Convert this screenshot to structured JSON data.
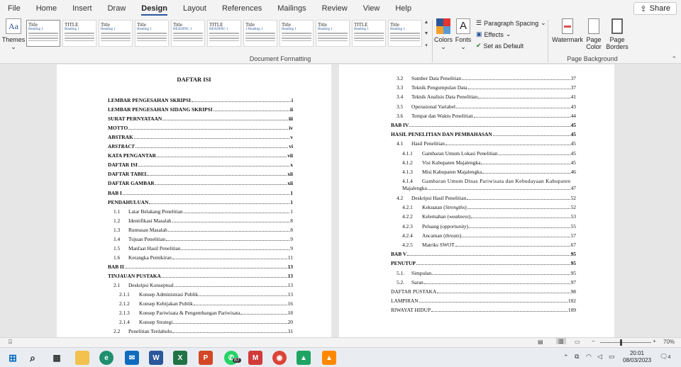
{
  "tabs": [
    "File",
    "Home",
    "Insert",
    "Draw",
    "Design",
    "Layout",
    "References",
    "Mailings",
    "Review",
    "View",
    "Help"
  ],
  "active_tab": "Design",
  "share_label": "Share",
  "ribbon": {
    "themes_label": "Themes",
    "gallery": [
      {
        "title": "Title",
        "sub": "Heading 1"
      },
      {
        "title": "TITLE",
        "sub": "Heading 1"
      },
      {
        "title": "Title",
        "sub": "Heading 1"
      },
      {
        "title": "Title",
        "sub": "Heading 1"
      },
      {
        "title": "Title",
        "sub": "HEADING 1"
      },
      {
        "title": "TITLE",
        "sub": "HEADING 1"
      },
      {
        "title": "Title",
        "sub": "1   Heading 1"
      },
      {
        "title": "Title",
        "sub": "Heading 1"
      },
      {
        "title": "Title",
        "sub": "Heading 1"
      },
      {
        "title": "TITLE",
        "sub": "Heading 1"
      },
      {
        "title": "Title",
        "sub": "Heading 1"
      }
    ],
    "colors_label": "Colors",
    "fonts_label": "Fonts",
    "paragraph_spacing_label": "Paragraph Spacing",
    "effects_label": "Effects",
    "set_default_label": "Set as Default",
    "document_formatting_label": "Document Formatting",
    "watermark_label": "Watermark",
    "page_color_label": "Page Color",
    "page_borders_label": "Page Borders",
    "page_background_label": "Page Background"
  },
  "page1": {
    "heading": "DAFTAR ISI",
    "entries": [
      {
        "num": "",
        "text": "LEMBAR PENGESAHAN SKRIPSI",
        "page": "i",
        "style": "b",
        "indent": 0
      },
      {
        "num": "",
        "text": "LEMBAR PENGESAHAN SIDANG SKRIPSI",
        "page": "ii",
        "style": "b",
        "indent": 0
      },
      {
        "num": "",
        "text": "SURAT PERNYATAAN",
        "page": "iii",
        "style": "b",
        "indent": 0
      },
      {
        "num": "",
        "text": "MOTTO",
        "page": "iv",
        "style": "b",
        "indent": 0
      },
      {
        "num": "",
        "text": "ABSTRAK",
        "page": "v",
        "style": "b",
        "indent": 0
      },
      {
        "num": "",
        "text": "ABSTRACT",
        "page": "vi",
        "style": "bi",
        "indent": 0
      },
      {
        "num": "",
        "text": "KATA PENGANTAR",
        "page": "vii",
        "style": "b",
        "indent": 0
      },
      {
        "num": "",
        "text": "DAFTAR ISI",
        "page": "x",
        "style": "b",
        "indent": 0
      },
      {
        "num": "",
        "text": "DAFTAR TABEL",
        "page": "xii",
        "style": "b",
        "indent": 0
      },
      {
        "num": "",
        "text": "DAFTAR GAMBAR",
        "page": "xii",
        "style": "b",
        "indent": 0
      },
      {
        "num": "",
        "text": "BAB I",
        "page": "1",
        "style": "b",
        "indent": 0
      },
      {
        "num": "",
        "text": "PENDAHULUAN",
        "page": "1",
        "style": "b",
        "indent": 0
      },
      {
        "num": "1.1",
        "text": "Latar Belakang Penelitian",
        "page": "1",
        "style": "",
        "indent": 1
      },
      {
        "num": "1.2",
        "text": "Identifikasi Masalah",
        "page": "8",
        "style": "",
        "indent": 1
      },
      {
        "num": "1.3",
        "text": "Rumusan Masalah",
        "page": "8",
        "style": "",
        "indent": 1
      },
      {
        "num": "1.4",
        "text": "Tujuan Penelitian",
        "page": "9",
        "style": "",
        "indent": 1
      },
      {
        "num": "1.5",
        "text": "Manfaat Hasil Penelitian",
        "page": "9",
        "style": "",
        "indent": 1
      },
      {
        "num": "1.6",
        "text": "Kerangka Pemikiran",
        "page": "11",
        "style": "",
        "indent": 1
      },
      {
        "num": "",
        "text": "BAB II",
        "page": "13",
        "style": "b",
        "indent": 0
      },
      {
        "num": "",
        "text": "TINJAUAN PUSTAKA",
        "page": "13",
        "style": "b",
        "indent": 0
      },
      {
        "num": "2.1",
        "text": "Deskripsi Konseptual",
        "page": "13",
        "style": "",
        "indent": 1
      },
      {
        "num": "2.1.1",
        "text": "Konsep Administrasi Publik",
        "page": "13",
        "style": "",
        "indent": 2
      },
      {
        "num": "2.1.2",
        "text": "Konsep Kebijakan Publik",
        "page": "16",
        "style": "",
        "indent": 2
      },
      {
        "num": "2.1.3",
        "text": "Konsep Pariwisata & Pengembangan Pariwisata",
        "page": "18",
        "style": "",
        "indent": 2
      },
      {
        "num": "2.1.4",
        "text": "Konsep Strategi",
        "page": "20",
        "style": "",
        "indent": 2
      },
      {
        "num": "2.2",
        "text": "Penelitian Terdahulu",
        "page": "31",
        "style": "",
        "indent": 1
      }
    ]
  },
  "page2": {
    "entries": [
      {
        "num": "3.2",
        "text": "Sumber Data Penelitian",
        "page": "37",
        "style": "",
        "indent": 1
      },
      {
        "num": "3.3",
        "text": "Teknik Pengumpulan Data",
        "page": "37",
        "style": "",
        "indent": 1
      },
      {
        "num": "3.4",
        "text": "Teknik Analisis Data Penelitian",
        "page": "41",
        "style": "",
        "indent": 1
      },
      {
        "num": "3.5",
        "text": "Operasional Variabel",
        "page": "43",
        "style": "",
        "indent": 1
      },
      {
        "num": "3.6",
        "text": "Tempat dan Waktu Penelitian",
        "page": "44",
        "style": "",
        "indent": 1
      },
      {
        "num": "",
        "text": "BAB IV",
        "page": "45",
        "style": "b",
        "indent": 0
      },
      {
        "num": "",
        "text": "HASIL PENELITIAN DAN PEMBAHASAN",
        "page": "45",
        "style": "b",
        "indent": 0
      },
      {
        "num": "4.1",
        "text": "Hasil Penelitian",
        "page": "45",
        "style": "",
        "indent": 1
      },
      {
        "num": "4.1.1",
        "text": "Gambaran Umum Lokasi Penelitian",
        "page": "45",
        "style": "",
        "indent": 2
      },
      {
        "num": "4.1.2",
        "text": "Visi Kabupaten Majalengka",
        "page": "45",
        "style": "",
        "indent": 2
      },
      {
        "num": "4.1.3",
        "text": "Misi Kabupaten Majalengka",
        "page": "46",
        "style": "",
        "indent": 2
      },
      {
        "num": "4.1.4",
        "text": "Gambaran Umum Dinas Pariwisata dan Kebudayaan Kabupaten",
        "cont": "Majalengka",
        "page": "47",
        "style": "",
        "indent": 2,
        "wrap": true
      },
      {
        "num": "4.2",
        "text": "Deskripsi Hasil Penelitian",
        "page": "52",
        "style": "",
        "indent": 1
      },
      {
        "num": "4.2.1",
        "text": "Kekuatan (",
        "em": "Strengths",
        "after": ")",
        "page": "52",
        "style": "",
        "indent": 2
      },
      {
        "num": "4.2.2",
        "text": "Kelemahan (",
        "em": "weakness",
        "after": ")",
        "page": "53",
        "style": "",
        "indent": 2
      },
      {
        "num": "4.2.3",
        "text": "Peluang (",
        "em": "opportunity",
        "after": ")",
        "page": "55",
        "style": "",
        "indent": 2
      },
      {
        "num": "4.2.4",
        "text": "Ancaman (",
        "em": "threats",
        "after": ")",
        "page": "57",
        "style": "",
        "indent": 2
      },
      {
        "num": "4.2.5",
        "text": "Matriks SWOT",
        "page": "67",
        "style": "",
        "indent": 2
      },
      {
        "num": "",
        "text": "BAB V",
        "page": "95",
        "style": "b",
        "indent": 0
      },
      {
        "num": "",
        "text": "PENUTUP",
        "page": "95",
        "style": "b",
        "indent": 0
      },
      {
        "num": "5.1.",
        "text": "Simpulan",
        "page": "95",
        "style": "",
        "indent": 1
      },
      {
        "num": "5.2.",
        "text": "Saran",
        "page": "97",
        "style": "",
        "indent": 1
      },
      {
        "num": "",
        "text": "DAFTAR PUSTAKA",
        "page": "98",
        "style": "",
        "indent": 0
      },
      {
        "num": "",
        "text": "LAMPIRAN",
        "page": "102",
        "style": "",
        "indent": 0
      },
      {
        "num": "",
        "text": "RIWAYAT HIDUP",
        "page": "109",
        "style": "",
        "indent": 0
      }
    ]
  },
  "statusbar": {
    "zoom": "70%",
    "minus": "−",
    "plus": "+"
  },
  "taskbar": {
    "time": "20:01",
    "date": "08/03/2023",
    "whatsapp_badge": "87",
    "notif_badge": "4"
  }
}
